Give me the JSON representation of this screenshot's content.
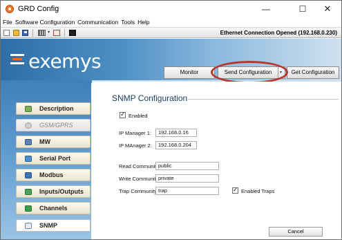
{
  "window": {
    "title": "GRD Config",
    "minimize_glyph": "—",
    "maximize_glyph": "☐",
    "close_glyph": "✕"
  },
  "menu": [
    "File",
    "Software Configuration",
    "Communication",
    "Tools",
    "Help"
  ],
  "toolbar": {
    "status": "Ethernet Connection Opened (192.168.0.230)",
    "dropdown_caret": "▾"
  },
  "brand": {
    "logo_text": "exemys"
  },
  "actions": {
    "monitor": "Monitor",
    "send_config": "Send Configuration",
    "send_caret": "▾",
    "get_config": "Get Configuration"
  },
  "nav": [
    {
      "label": "Description",
      "icon": "description-icon",
      "state": "normal"
    },
    {
      "label": "GSM/GPRS",
      "icon": "gsm-icon",
      "state": "disabled"
    },
    {
      "label": "MW",
      "icon": "mw-icon",
      "state": "normal"
    },
    {
      "label": "Serial Port",
      "icon": "serial-port-icon",
      "state": "normal"
    },
    {
      "label": "Modbus",
      "icon": "modbus-icon",
      "state": "normal"
    },
    {
      "label": "Inputs/Outputs",
      "icon": "io-icon",
      "state": "normal"
    },
    {
      "label": "Channels",
      "icon": "channels-icon",
      "state": "normal"
    },
    {
      "label": "SNMP",
      "icon": "snmp-icon",
      "state": "active"
    }
  ],
  "snmp": {
    "title": "SNMP Configuration",
    "enabled_label": "Enabled",
    "enabled": true,
    "ip_manager1_label": "IP Manager 1:",
    "ip_manager1": "192.168.0.16",
    "ip_manager2_label": "IP MAnager 2:",
    "ip_manager2": "192.168.0.204",
    "read_community_label": "Read Community:",
    "read_community": "public",
    "write_community_label": "Write Community:",
    "write_community": "private",
    "trap_community_label": "Trap Community:",
    "trap_community": "trap",
    "enabled_traps_label": "Enabled Traps",
    "enabled_traps": true,
    "check_glyph": "✓",
    "cancel_label": "Cancel"
  },
  "colors": {
    "accent": "#1b3f66",
    "highlight": "#b8352c",
    "brand_orange": "#f26b20"
  }
}
